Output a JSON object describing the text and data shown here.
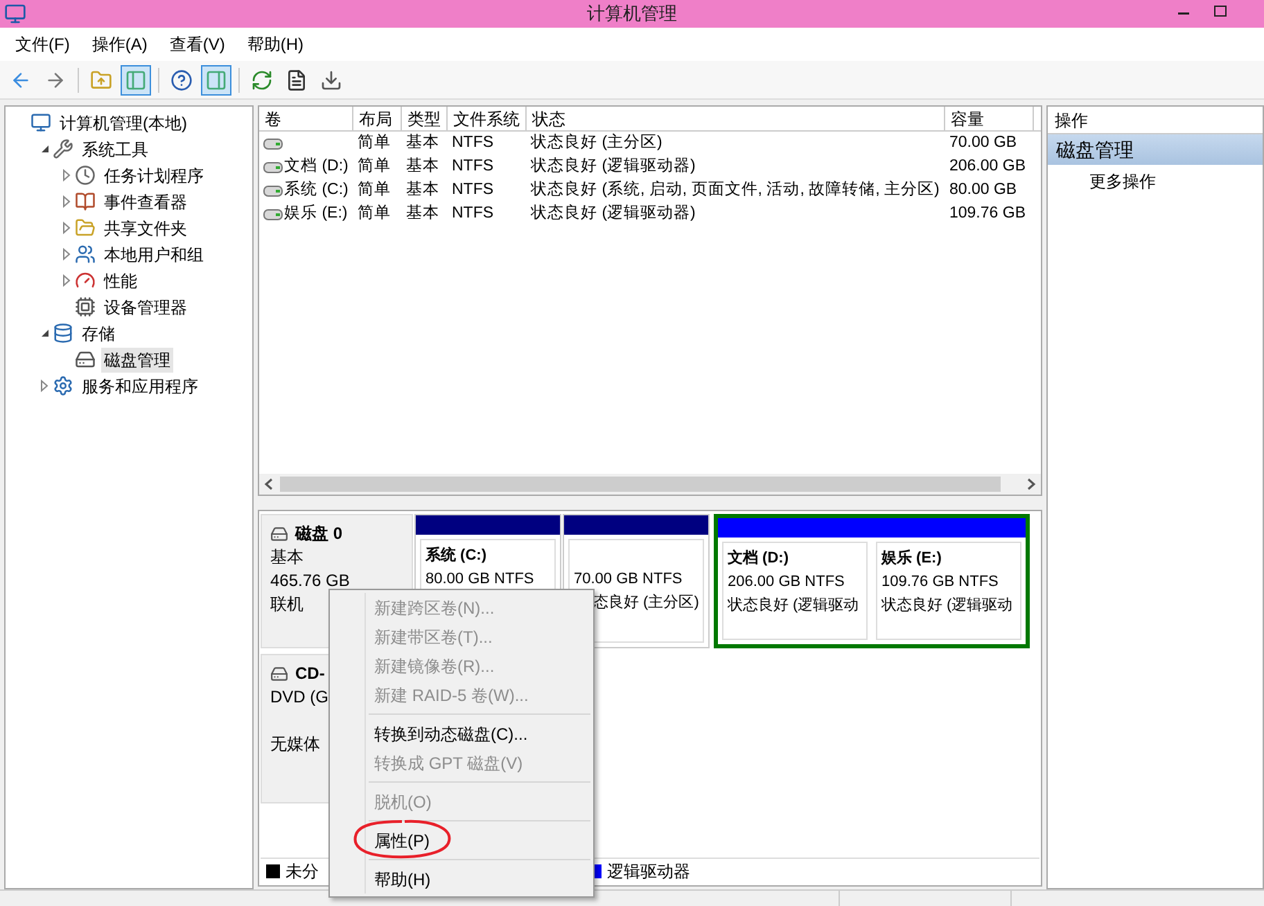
{
  "window": {
    "title": "计算机管理"
  },
  "menu": [
    "文件(F)",
    "操作(A)",
    "查看(V)",
    "帮助(H)"
  ],
  "toolbar": [
    {
      "kind": "back",
      "pressed": false
    },
    {
      "kind": "forward",
      "pressed": false
    },
    {
      "kind": "separator"
    },
    {
      "kind": "up",
      "pressed": false
    },
    {
      "kind": "tree",
      "pressed": true
    },
    {
      "kind": "separator"
    },
    {
      "kind": "help",
      "pressed": false
    },
    {
      "kind": "pane",
      "pressed": true
    },
    {
      "kind": "separator"
    },
    {
      "kind": "refresh",
      "pressed": false
    },
    {
      "kind": "properties",
      "pressed": false
    },
    {
      "kind": "export",
      "pressed": false
    }
  ],
  "tree": [
    {
      "label": "计算机管理(本地)",
      "selected": false,
      "children": [
        {
          "label": "系统工具",
          "expanded": true,
          "selected": false,
          "children": [
            {
              "label": "任务计划程序",
              "expanded": false,
              "selected": false
            },
            {
              "label": "事件查看器",
              "expanded": false,
              "selected": false
            },
            {
              "label": "共享文件夹",
              "expanded": false,
              "selected": false
            },
            {
              "label": "本地用户和组",
              "expanded": false,
              "selected": false
            },
            {
              "label": "性能",
              "expanded": false,
              "selected": false
            },
            {
              "label": "设备管理器",
              "selected": false
            }
          ]
        },
        {
          "label": "存储",
          "expanded": true,
          "selected": false,
          "children": [
            {
              "label": "磁盘管理",
              "selected": true
            }
          ]
        },
        {
          "label": "服务和应用程序",
          "expanded": false,
          "selected": false
        }
      ]
    }
  ],
  "table": {
    "columns": [
      "卷",
      "布局",
      "类型",
      "文件系统",
      "状态",
      "容量"
    ],
    "rows": [
      [
        null,
        "简单",
        "基本",
        "NTFS",
        "状态良好 (主分区)",
        "70.00 GB"
      ],
      [
        "文档 (D:)",
        "简单",
        "基本",
        "NTFS",
        "状态良好 (逻辑驱动器)",
        "206.00 GB"
      ],
      [
        "系统 (C:)",
        "简单",
        "基本",
        "NTFS",
        "状态良好 (系统, 启动, 页面文件, 活动, 故障转储, 主分区)",
        "80.00 GB"
      ],
      [
        "娱乐 (E:)",
        "简单",
        "基本",
        "NTFS",
        "状态良好 (逻辑驱动器)",
        "109.76 GB"
      ]
    ]
  },
  "disks": [
    {
      "kind": "basic",
      "name": "磁盘 0",
      "lines": [
        "基本",
        "465.76 GB",
        "联机"
      ],
      "partitions": [
        {
          "name": "系统 (C:)",
          "size": "80.00 GB NTFS",
          "color": "#000080",
          "extended": false
        },
        {
          "size": "70.00 GB NTFS",
          "status": "态良好 (主分区)",
          "color": "#000080",
          "extended": false
        },
        {
          "name": "文档 (D:)",
          "size": "206.00 GB NTFS",
          "status": "状态良好 (逻辑驱动",
          "color": "#0000ff",
          "extended": true
        },
        {
          "name": "娱乐 (E:)",
          "size": "109.76 GB NTFS",
          "status": "状态良好 (逻辑驱动",
          "color": "#0000ff",
          "extended": true
        }
      ]
    },
    {
      "kind": "cdrom",
      "name": "CD-",
      "lines": [
        "DVD (G",
        "无媒体"
      ]
    }
  ],
  "legend": [
    {
      "label": "未分",
      "color": "#000000"
    },
    {
      "label": "逻辑驱动器",
      "color": "#0000ff"
    }
  ],
  "actions": {
    "header": "操作",
    "section": "磁盘管理",
    "items": [
      "更多操作"
    ]
  },
  "context_menu": [
    {
      "kind": "item",
      "label": "新建跨区卷(N)...",
      "disabled": true
    },
    {
      "kind": "item",
      "label": "新建带区卷(T)...",
      "disabled": true
    },
    {
      "kind": "item",
      "label": "新建镜像卷(R)...",
      "disabled": true
    },
    {
      "kind": "item",
      "label": "新建 RAID-5 卷(W)...",
      "disabled": true
    },
    {
      "kind": "separator"
    },
    {
      "kind": "item",
      "label": "转换到动态磁盘(C)...",
      "disabled": false
    },
    {
      "kind": "item",
      "label": "转换成 GPT 磁盘(V)",
      "disabled": true
    },
    {
      "kind": "separator"
    },
    {
      "kind": "item",
      "label": "脱机(O)",
      "disabled": true
    },
    {
      "kind": "separator"
    },
    {
      "kind": "item",
      "label": "属性(P)",
      "disabled": false,
      "circled": true
    },
    {
      "kind": "separator"
    },
    {
      "kind": "item",
      "label": "帮助(H)",
      "disabled": false
    }
  ]
}
